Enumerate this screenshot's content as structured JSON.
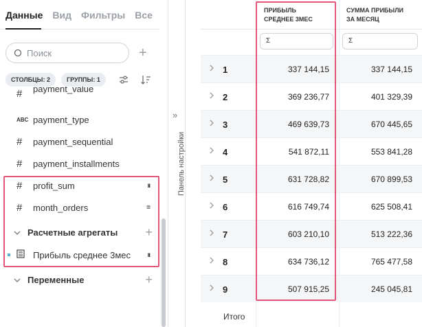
{
  "tabs": [
    "Данные",
    "Вид",
    "Фильтры",
    "Все"
  ],
  "search": {
    "placeholder": "Поиск"
  },
  "chips": {
    "columns": "СТОЛБЦЫ: 2",
    "groups": "ГРУППЫ: 1"
  },
  "fields": [
    {
      "type": "#",
      "name": "payment_value"
    },
    {
      "type": "ABC",
      "name": "payment_type"
    },
    {
      "type": "#",
      "name": "payment_sequential"
    },
    {
      "type": "#",
      "name": "payment_installments"
    },
    {
      "type": "#",
      "name": "profit_sum"
    },
    {
      "type": "#",
      "name": "month_orders"
    }
  ],
  "sections": {
    "calc": "Расчетные агрегаты",
    "calc_item": "Прибыль среднее 3мес",
    "vars": "Переменные"
  },
  "side_panel_label": "Панель настройки",
  "table": {
    "col1_header": [
      "ПРИБЫЛЬ",
      "СРЕДНЕЕ 3МЕС"
    ],
    "col2_header": [
      "СУММА ПРИБЫЛИ",
      "ЗА МЕСЯЦ"
    ],
    "filter_symbol": "Σ",
    "rows": [
      {
        "n": "1",
        "a": "337 144,15",
        "b": "337 144,15"
      },
      {
        "n": "2",
        "a": "369 236,77",
        "b": "401 329,39"
      },
      {
        "n": "3",
        "a": "469 639,73",
        "b": "670 445,65"
      },
      {
        "n": "4",
        "a": "541 872,11",
        "b": "553 841,28"
      },
      {
        "n": "5",
        "a": "631 728,82",
        "b": "670 899,53"
      },
      {
        "n": "6",
        "a": "616 749,74",
        "b": "625 508,41"
      },
      {
        "n": "7",
        "a": "603 210,10",
        "b": "513 222,36"
      },
      {
        "n": "8",
        "a": "634 736,12",
        "b": "765 477,58"
      },
      {
        "n": "9",
        "a": "507 915,25",
        "b": "245 045,81"
      }
    ],
    "total_label": "Итого"
  },
  "colors": {
    "highlight": "#e3567a",
    "chip_bg": "#e9edf1"
  }
}
